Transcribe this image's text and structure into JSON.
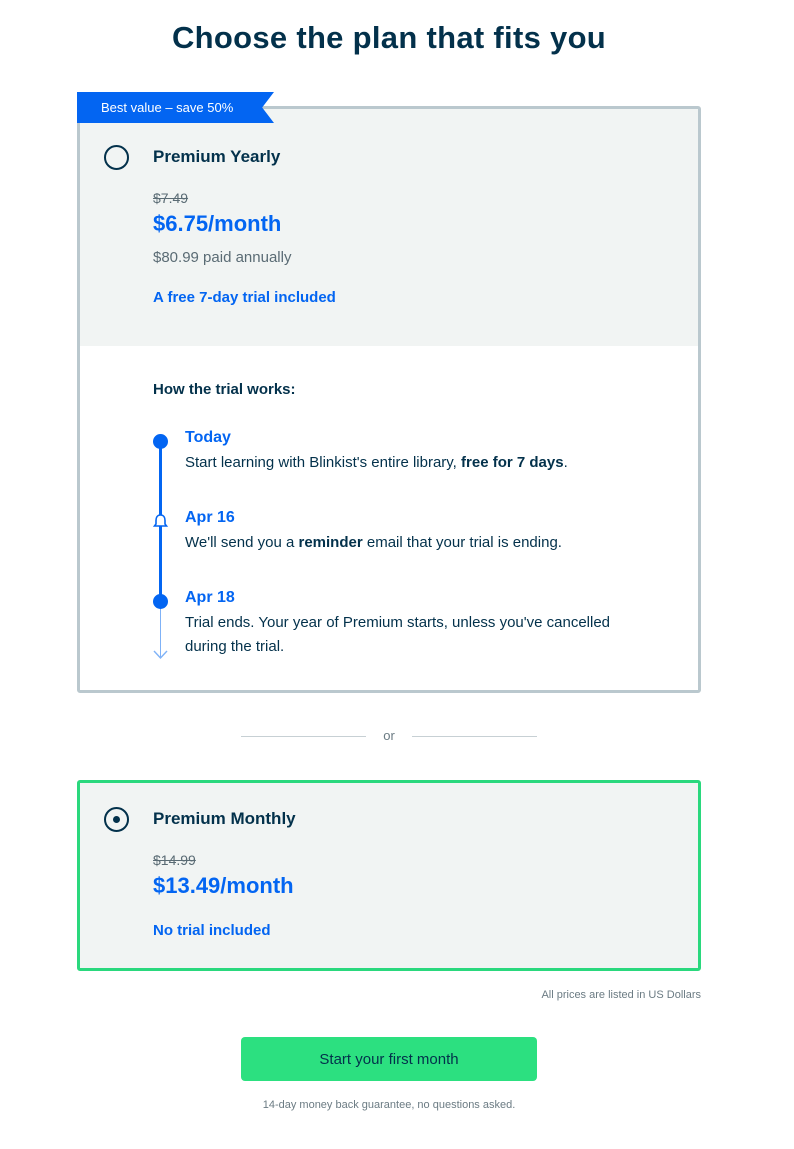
{
  "title": "Choose the plan that fits you",
  "yearly": {
    "badge": "Best value – save 50%",
    "name": "Premium Yearly",
    "old_price": "$7.49",
    "price": "$6.75/month",
    "annual": "$80.99 paid annually",
    "trial": "A free 7-day trial included",
    "how_title": "How the trial works:",
    "steps": [
      {
        "date": "Today",
        "text_before": "Start learning with Blinkist's entire library, ",
        "text_bold": "free for 7 days",
        "text_after": "."
      },
      {
        "date": "Apr 16",
        "text_before": "We'll send you a ",
        "text_bold": "reminder",
        "text_after": " email that your trial is ending."
      },
      {
        "date": "Apr 18",
        "line1": "Trial ends. Your year of Premium starts, unless you've cancelled",
        "line2": "during the trial."
      }
    ]
  },
  "separator": "or",
  "monthly": {
    "name": "Premium Monthly",
    "old_price": "$14.99",
    "price": "$13.49/month",
    "trial": "No trial included",
    "selected": true
  },
  "currency_note": "All prices are listed in US Dollars",
  "cta_label": "Start your first month",
  "guarantee": "14-day money back guarantee, no questions asked.",
  "colors": {
    "brand_blue": "#0365f2",
    "brand_green": "#2ad87d",
    "text_dark": "#03314b"
  },
  "icons": {
    "radio_unselected": "radio-empty-icon",
    "radio_selected": "radio-selected-icon",
    "reminder": "bell-icon",
    "timeline_end": "arrow-down-icon"
  }
}
